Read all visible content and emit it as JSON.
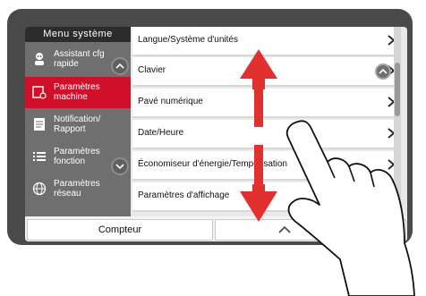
{
  "sidebar": {
    "title": "Menu système",
    "items": [
      {
        "label": "Assistant cfg rapide",
        "icon": "wizard-icon",
        "active": false
      },
      {
        "label": "Paramètres machine",
        "icon": "machine-settings-icon",
        "active": true
      },
      {
        "label": "Notification/ Rapport",
        "icon": "report-icon",
        "active": false
      },
      {
        "label": "Paramètres fonction",
        "icon": "function-list-icon",
        "active": false
      },
      {
        "label": "Paramètres réseau",
        "icon": "network-globe-icon",
        "active": false
      }
    ]
  },
  "list": {
    "items": [
      "Langue/Système d'unités",
      "Clavier",
      "Pavé numérique",
      "Date/Heure",
      "Économiseur d'énergie/Temporisation",
      "Paramètres d'affichage"
    ]
  },
  "bottom": {
    "counter_label": "Compteur"
  },
  "colors": {
    "accent": "#d0102b",
    "arrow": "#e03030",
    "panel": "#4a4a4a"
  }
}
